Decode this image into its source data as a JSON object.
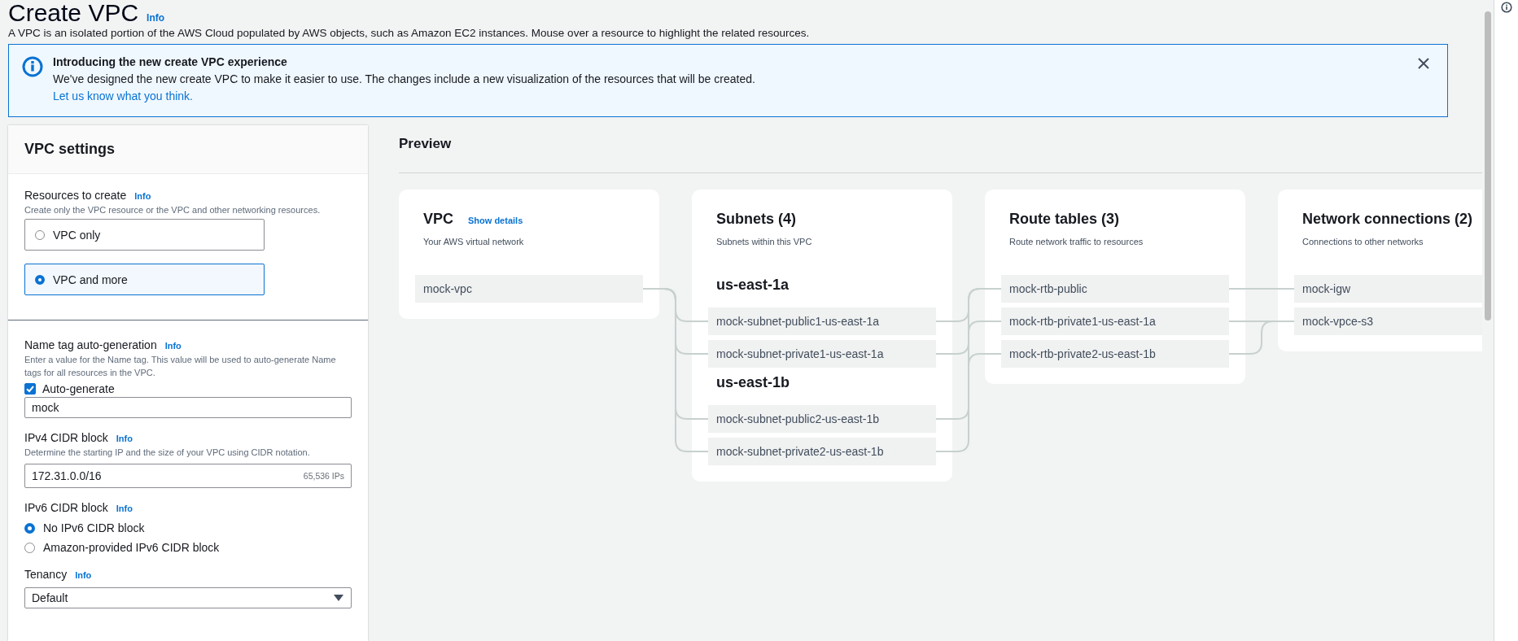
{
  "page": {
    "title": "Create VPC",
    "info": "Info",
    "description": "A VPC is an isolated portion of the AWS Cloud populated by AWS objects, such as Amazon EC2 instances. Mouse over a resource to highlight the related resources."
  },
  "flash": {
    "title": "Introducing the new create VPC experience",
    "message": "We've designed the new create VPC to make it easier to use. The changes include a new visualization of the resources that will be created.",
    "link": "Let us know what you think."
  },
  "settings": {
    "title": "VPC settings",
    "sections": [
      {
        "fields": [
          {
            "kind": "tiles",
            "label": "Resources to create",
            "info": "Info",
            "description": "Create only the VPC resource or the VPC and other networking resources.",
            "options": [
              {
                "label": "VPC only",
                "selected": false
              },
              {
                "label": "VPC and more",
                "selected": true
              }
            ]
          }
        ]
      },
      {
        "fields": [
          {
            "kind": "name_tag",
            "label": "Name tag auto-generation",
            "info": "Info",
            "description": "Enter a value for the Name tag. This value will be used to auto-generate Name tags for all resources in the VPC.",
            "checkbox": {
              "label": "Auto-generate",
              "checked": true
            },
            "value": "mock"
          },
          {
            "kind": "cidr",
            "label": "IPv4 CIDR block",
            "info": "Info",
            "description": "Determine the starting IP and the size of your VPC using CIDR notation.",
            "value": "172.31.0.0/16",
            "hint": "65,536 IPs"
          },
          {
            "kind": "radios",
            "label": "IPv6 CIDR block",
            "info": "Info",
            "options": [
              {
                "label": "No IPv6 CIDR block",
                "selected": true
              },
              {
                "label": "Amazon-provided IPv6 CIDR block",
                "selected": false
              }
            ]
          },
          {
            "kind": "select",
            "label": "Tenancy",
            "info": "Info",
            "value": "Default"
          }
        ]
      }
    ]
  },
  "preview": {
    "title": "Preview",
    "columns": [
      {
        "title": "VPC",
        "link": "Show details",
        "subtitle": "Your AWS virtual network",
        "groups": [
          {
            "items": [
              "mock-vpc"
            ]
          }
        ]
      },
      {
        "title": "Subnets (4)",
        "subtitle": "Subnets within this VPC",
        "groups": [
          {
            "heading": "us-east-1a",
            "items": [
              "mock-subnet-public1-us-east-1a",
              "mock-subnet-private1-us-east-1a"
            ]
          },
          {
            "heading": "us-east-1b",
            "items": [
              "mock-subnet-public2-us-east-1b",
              "mock-subnet-private2-us-east-1b"
            ]
          }
        ]
      },
      {
        "title": "Route tables (3)",
        "subtitle": "Route network traffic to resources",
        "groups": [
          {
            "items": [
              "mock-rtb-public",
              "mock-rtb-private1-us-east-1a",
              "mock-rtb-private2-us-east-1b"
            ]
          }
        ]
      },
      {
        "title": "Network connections (2)",
        "subtitle": "Connections to other networks",
        "groups": [
          {
            "items": [
              "mock-igw",
              "mock-vpce-s3"
            ]
          }
        ]
      }
    ]
  }
}
